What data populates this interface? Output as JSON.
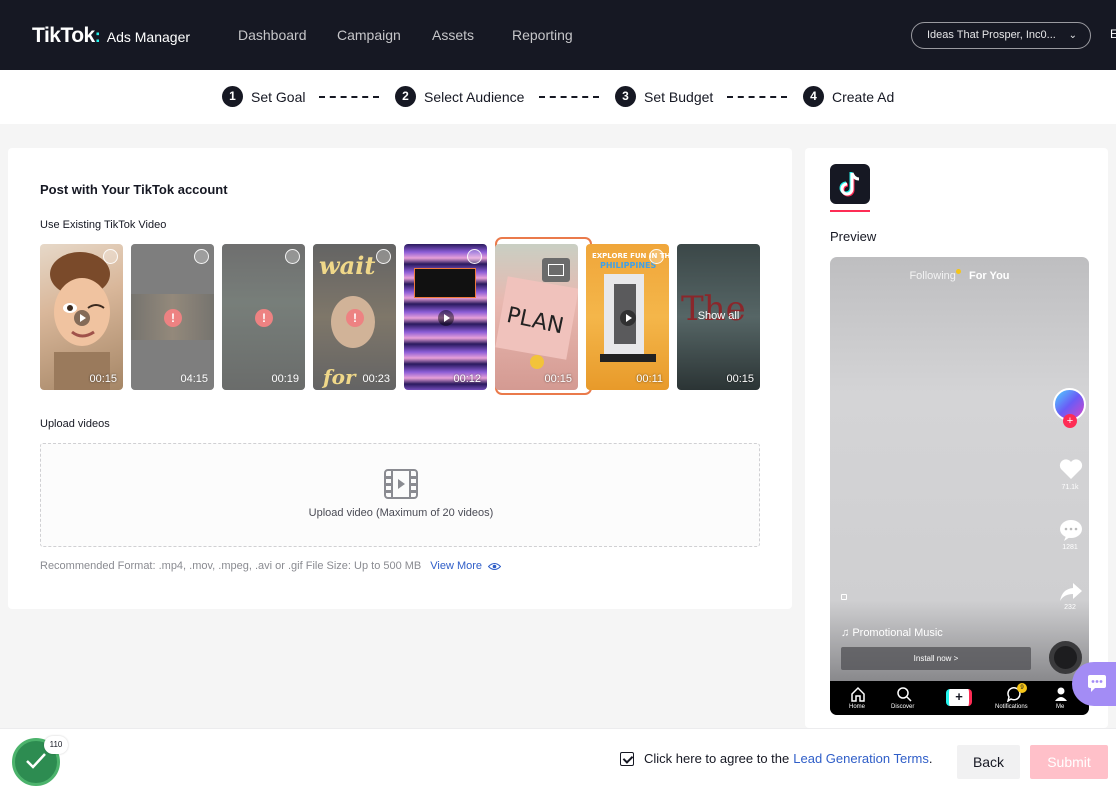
{
  "brand": {
    "logo_main": "TikTok",
    "logo_sub": "Ads Manager"
  },
  "nav": {
    "items": [
      "Dashboard",
      "Campaign",
      "Assets",
      "Reporting"
    ],
    "account": "Ideas That Prosper, Inc0...",
    "truncated": "E"
  },
  "steps": [
    {
      "num": "1",
      "label": "Set Goal"
    },
    {
      "num": "2",
      "label": "Select Audience"
    },
    {
      "num": "3",
      "label": "Set Budget"
    },
    {
      "num": "4",
      "label": "Create Ad"
    }
  ],
  "main": {
    "title": "Post with Your TikTok account",
    "existing_label": "Use Existing TikTok Video",
    "show_all": "Show all",
    "videos": [
      {
        "duration": "00:15",
        "status": "play",
        "selected": false
      },
      {
        "duration": "04:15",
        "status": "error",
        "selected": false
      },
      {
        "duration": "00:19",
        "status": "error",
        "selected": false
      },
      {
        "duration": "00:23",
        "status": "error",
        "selected": false
      },
      {
        "duration": "00:12",
        "status": "play",
        "selected": false
      },
      {
        "duration": "00:15",
        "status": "play",
        "selected": true
      },
      {
        "duration": "00:11",
        "status": "play",
        "selected": false
      },
      {
        "duration": "00:15",
        "status": "show-all",
        "selected": false
      }
    ],
    "upload_label": "Upload videos",
    "upload_text": "Upload video (Maximum of 20 videos)",
    "format_text": "Recommended Format: .mp4, .mov, .mpeg, .avi or .gif File Size: Up to 500 MB",
    "view_more": "View More"
  },
  "preview": {
    "label": "Preview",
    "tab_following": "Following",
    "tab_for_you": "For You",
    "likes": "71.1k",
    "comments": "1281",
    "shares": "232",
    "music": "Promotional Music",
    "install": "Install now >",
    "bottom_nav": [
      "Home",
      "Discover",
      "Notifications",
      "Me"
    ],
    "notif_badge": "9"
  },
  "footer": {
    "progress_count": "110",
    "agree_text": "Click here to agree to the",
    "terms_link": "Lead Generation Terms",
    "period": ".",
    "back": "Back",
    "submit": "Submit"
  },
  "colors": {
    "nav_bg": "#161823",
    "accent_pink": "#fe2c55",
    "link_blue": "#2f5ec8",
    "selected_border": "#ea7a4b"
  }
}
